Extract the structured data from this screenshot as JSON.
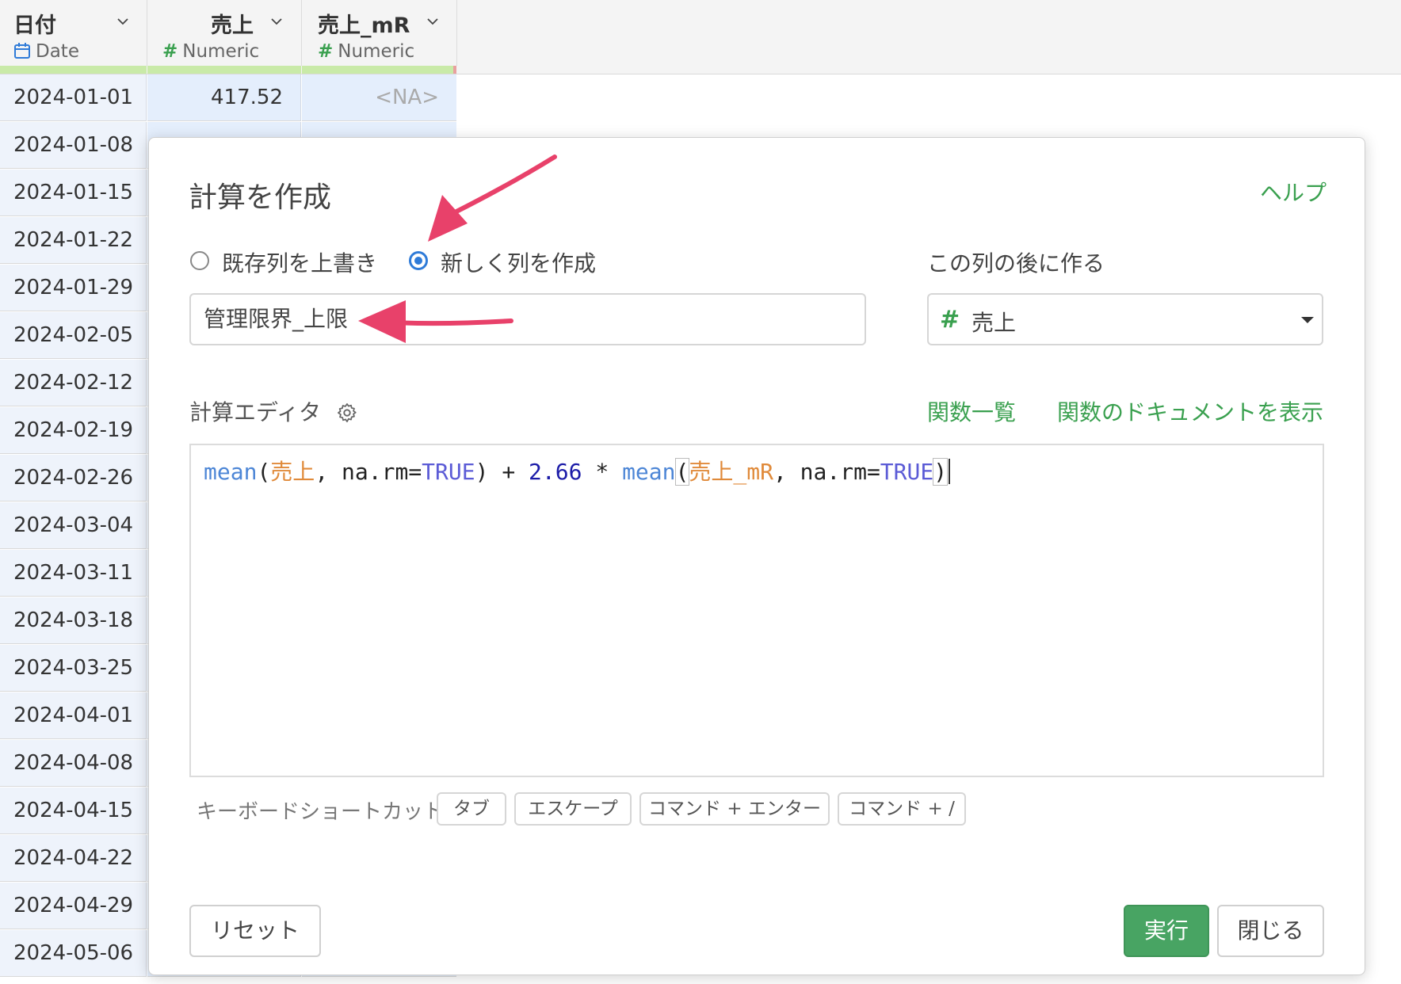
{
  "table": {
    "columns": [
      {
        "name": "日付",
        "type": "Date"
      },
      {
        "name": "売上",
        "type": "Numeric"
      },
      {
        "name": "売上_mR",
        "type": "Numeric"
      }
    ],
    "first_row": {
      "date": "2024-01-01",
      "sales": "417.52",
      "mr": "<NA>"
    },
    "dates": [
      "2024-01-01",
      "2024-01-08",
      "2024-01-15",
      "2024-01-22",
      "2024-01-29",
      "2024-02-05",
      "2024-02-12",
      "2024-02-19",
      "2024-02-26",
      "2024-03-04",
      "2024-03-11",
      "2024-03-18",
      "2024-03-25",
      "2024-04-01",
      "2024-04-08",
      "2024-04-15",
      "2024-04-22",
      "2024-04-29",
      "2024-05-06"
    ]
  },
  "dialog": {
    "title": "計算を作成",
    "help": "ヘルプ",
    "radio_overwrite": "既存列を上書き",
    "radio_new": "新しく列を作成",
    "selected_mode": "新しく列を作成",
    "column_name_value": "管理限界_上限",
    "after_label": "この列の後に作る",
    "after_value": "売上",
    "editor_label": "計算エディタ",
    "functions_link": "関数一覧",
    "docs_link": "関数のドキュメントを表示",
    "code": {
      "fn1": "mean",
      "col1": "売上",
      "arg1": ", na.rm=",
      "true1": "TRUE",
      "op": " + ",
      "num": "2.66",
      "mul": " * ",
      "fn2": "mean",
      "col2": "売上_mR",
      "arg2": ", na.rm=",
      "true2": "TRUE"
    },
    "shortcuts_label": "キーボードショートカット:",
    "shortcuts": [
      "タブ",
      "エスケープ",
      "コマンド + エンター",
      "コマンド + /"
    ],
    "reset": "リセット",
    "run": "実行",
    "close": "閉じる"
  },
  "colors": {
    "accent_green": "#3aa04f",
    "run_button": "#48a463",
    "annotation_arrow": "#e8416a",
    "radio_blue": "#2f7bd8"
  }
}
